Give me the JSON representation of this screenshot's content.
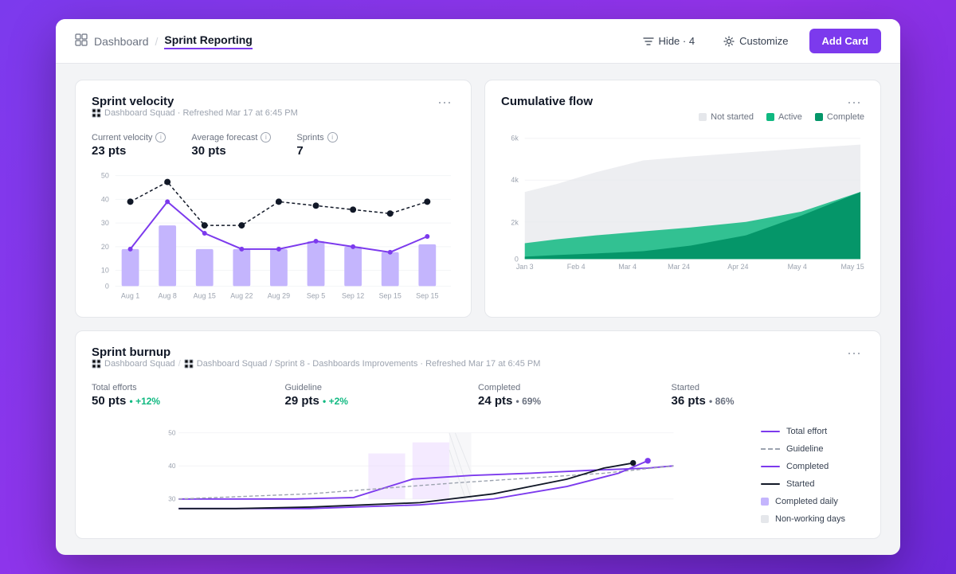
{
  "header": {
    "nav_icon": "⊞",
    "breadcrumb_parent": "Dashboard",
    "breadcrumb_separator": "/",
    "breadcrumb_active": "Sprint Reporting",
    "hide_label": "Hide · 4",
    "customize_label": "Customize",
    "add_card_label": "Add Card"
  },
  "sprint_velocity": {
    "title": "Sprint velocity",
    "subtitle": "Dashboard Squad · Refreshed Mar 17 at 6:45 PM",
    "metrics": {
      "current_velocity_label": "Current velocity",
      "current_velocity_value": "23 pts",
      "average_forecast_label": "Average forecast",
      "average_forecast_value": "30 pts",
      "sprints_label": "Sprints",
      "sprints_value": "7"
    },
    "x_labels": [
      "Aug 1",
      "Aug 8",
      "Aug 15",
      "Aug 22",
      "Aug 29",
      "Sep 5",
      "Sep 12",
      "Sep 15",
      "Sep 15"
    ],
    "y_labels": [
      "0",
      "10",
      "20",
      "30",
      "40",
      "50"
    ]
  },
  "cumulative_flow": {
    "title": "Cumulative flow",
    "y_labels": [
      "0",
      "2k",
      "4k",
      "6k"
    ],
    "x_labels": [
      "Jan 3",
      "Feb 4",
      "Mar 4",
      "Mar 24",
      "Apr 24",
      "May 4",
      "May 15"
    ],
    "legend": [
      {
        "label": "Not started",
        "color": "#e5e7eb"
      },
      {
        "label": "Active",
        "color": "#10b981"
      },
      {
        "label": "Complete",
        "color": "#059669"
      }
    ]
  },
  "sprint_burnup": {
    "title": "Sprint burnup",
    "subtitle": "Dashboard Squad / Sprint 8 - Dashboards Improvements · Refreshed Mar 17 at 6:45 PM",
    "metrics": [
      {
        "label": "Total efforts",
        "value": "50 pts",
        "change": "+12%",
        "positive": true
      },
      {
        "label": "Guideline",
        "value": "29 pts",
        "change": "+2%",
        "positive": true
      },
      {
        "label": "Completed",
        "value": "24 pts",
        "change": "69%",
        "positive": false
      },
      {
        "label": "Started",
        "value": "36 pts",
        "change": "86%",
        "positive": false
      }
    ],
    "y_labels": [
      "30",
      "40",
      "50"
    ],
    "legend": [
      {
        "label": "Total effort",
        "type": "solid",
        "color": "#7c3aed"
      },
      {
        "label": "Guideline",
        "type": "dashed",
        "color": "#9ca3af"
      },
      {
        "label": "Completed",
        "type": "solid",
        "color": "#7c3aed"
      },
      {
        "label": "Started",
        "type": "solid",
        "color": "#111827"
      },
      {
        "label": "Completed daily",
        "type": "box",
        "color": "#c4b5fd"
      },
      {
        "label": "Non-working days",
        "type": "box",
        "color": "#e5e7eb"
      }
    ]
  }
}
